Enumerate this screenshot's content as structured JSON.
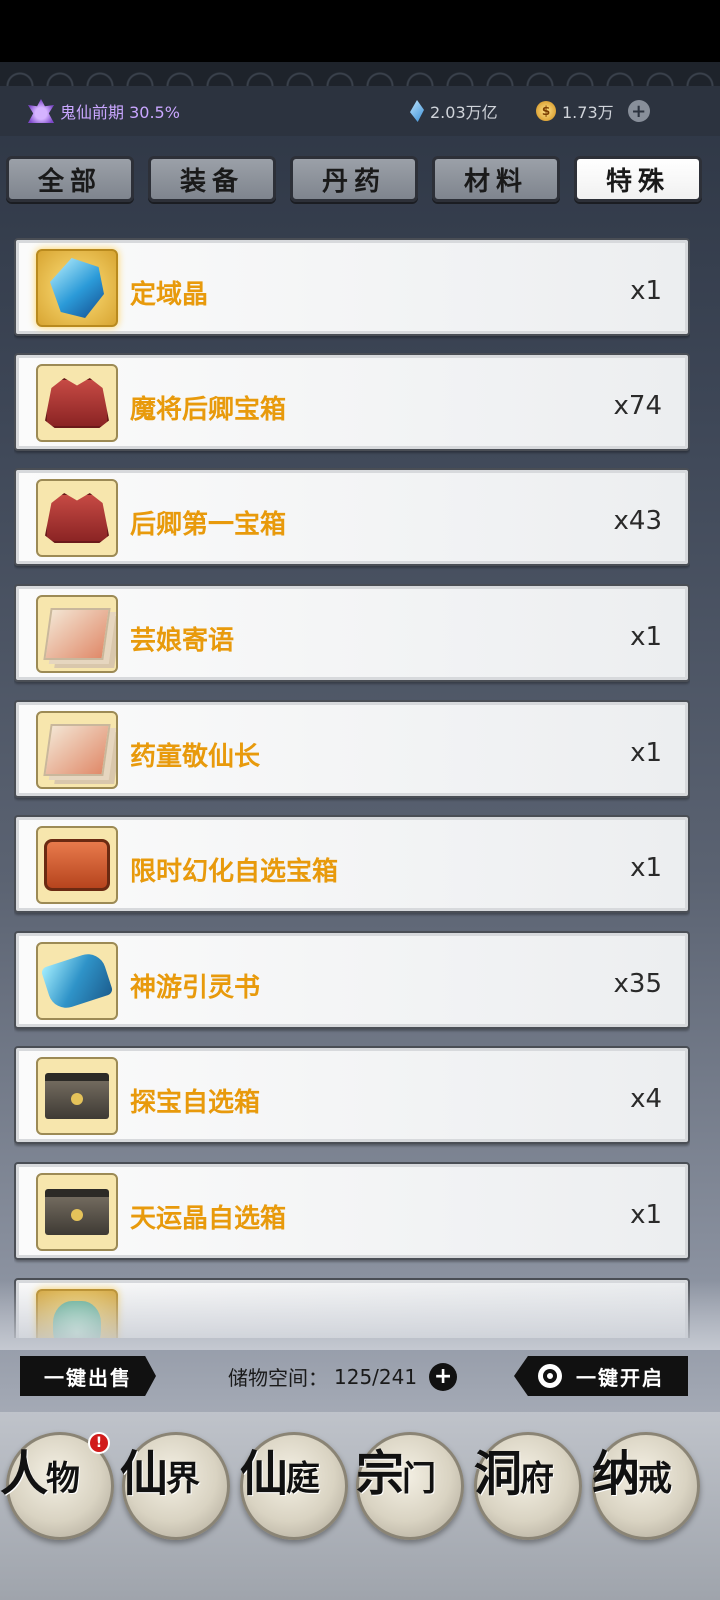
{
  "status": {
    "realm_label": "鬼仙前期 30.5%",
    "spirit_stones": "2.03万亿",
    "gold": "1.73万",
    "add_symbol": "+"
  },
  "tabs": [
    {
      "label": "全部",
      "active": false
    },
    {
      "label": "装备",
      "active": false
    },
    {
      "label": "丹药",
      "active": false
    },
    {
      "label": "材料",
      "active": false
    },
    {
      "label": "特殊",
      "active": true
    }
  ],
  "items": [
    {
      "name": "定域晶",
      "count": "x1",
      "icon": "crystal-icon"
    },
    {
      "name": "魔将后卿宝箱",
      "count": "x74",
      "icon": "red-chest-icon"
    },
    {
      "name": "后卿第一宝箱",
      "count": "x43",
      "icon": "red-chest-icon"
    },
    {
      "name": "芸娘寄语",
      "count": "x1",
      "icon": "letter-cards-icon"
    },
    {
      "name": "药童敬仙长",
      "count": "x1",
      "icon": "letter-cards-icon"
    },
    {
      "name": "限时幻化自选宝箱",
      "count": "x1",
      "icon": "orange-chest-icon"
    },
    {
      "name": "神游引灵书",
      "count": "x35",
      "icon": "blue-scroll-icon"
    },
    {
      "name": "探宝自选箱",
      "count": "x4",
      "icon": "dark-box-icon"
    },
    {
      "name": "天运晶自选箱",
      "count": "x1",
      "icon": "dark-box-icon"
    },
    {
      "name": "",
      "count": "",
      "icon": "jade-bag-icon"
    }
  ],
  "bottom": {
    "sell_all": "一键出售",
    "storage_label": "储物空间：",
    "storage_value": "125/241",
    "open_all": "一键开启"
  },
  "nav": [
    {
      "c1": "人",
      "c2": "物",
      "badge": "!"
    },
    {
      "c1": "仙",
      "c2": "界"
    },
    {
      "c1": "仙",
      "c2": "庭"
    },
    {
      "c1": "宗",
      "c2": "门"
    },
    {
      "c1": "洞",
      "c2": "府"
    },
    {
      "c1": "纳",
      "c2": "戒"
    }
  ]
}
